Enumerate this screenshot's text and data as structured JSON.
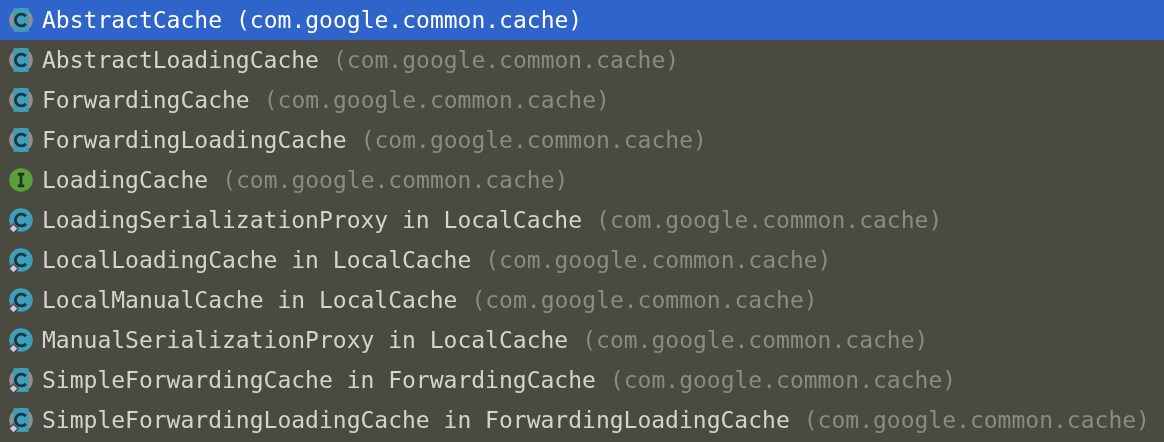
{
  "items": [
    {
      "name": "AbstractCache",
      "package": "(com.google.common.cache)",
      "kind": "abstract",
      "nested": false,
      "selected": true
    },
    {
      "name": "AbstractLoadingCache",
      "package": "(com.google.common.cache)",
      "kind": "abstract",
      "nested": false,
      "selected": false
    },
    {
      "name": "ForwardingCache",
      "package": "(com.google.common.cache)",
      "kind": "abstract",
      "nested": false,
      "selected": false
    },
    {
      "name": "ForwardingLoadingCache",
      "package": "(com.google.common.cache)",
      "kind": "abstract",
      "nested": false,
      "selected": false
    },
    {
      "name": "LoadingCache",
      "package": "(com.google.common.cache)",
      "kind": "interface",
      "nested": false,
      "selected": false
    },
    {
      "name": "LoadingSerializationProxy in LocalCache",
      "package": "(com.google.common.cache)",
      "kind": "class",
      "nested": true,
      "selected": false
    },
    {
      "name": "LocalLoadingCache in LocalCache",
      "package": "(com.google.common.cache)",
      "kind": "class",
      "nested": true,
      "selected": false
    },
    {
      "name": "LocalManualCache in LocalCache",
      "package": "(com.google.common.cache)",
      "kind": "class",
      "nested": true,
      "selected": false
    },
    {
      "name": "ManualSerializationProxy in LocalCache",
      "package": "(com.google.common.cache)",
      "kind": "class",
      "nested": true,
      "selected": false
    },
    {
      "name": "SimpleForwardingCache in ForwardingCache",
      "package": "(com.google.common.cache)",
      "kind": "abstract",
      "nested": true,
      "selected": false
    },
    {
      "name": "SimpleForwardingLoadingCache in ForwardingLoadingCache",
      "package": "(com.google.common.cache)",
      "kind": "abstract",
      "nested": true,
      "selected": false
    }
  ]
}
